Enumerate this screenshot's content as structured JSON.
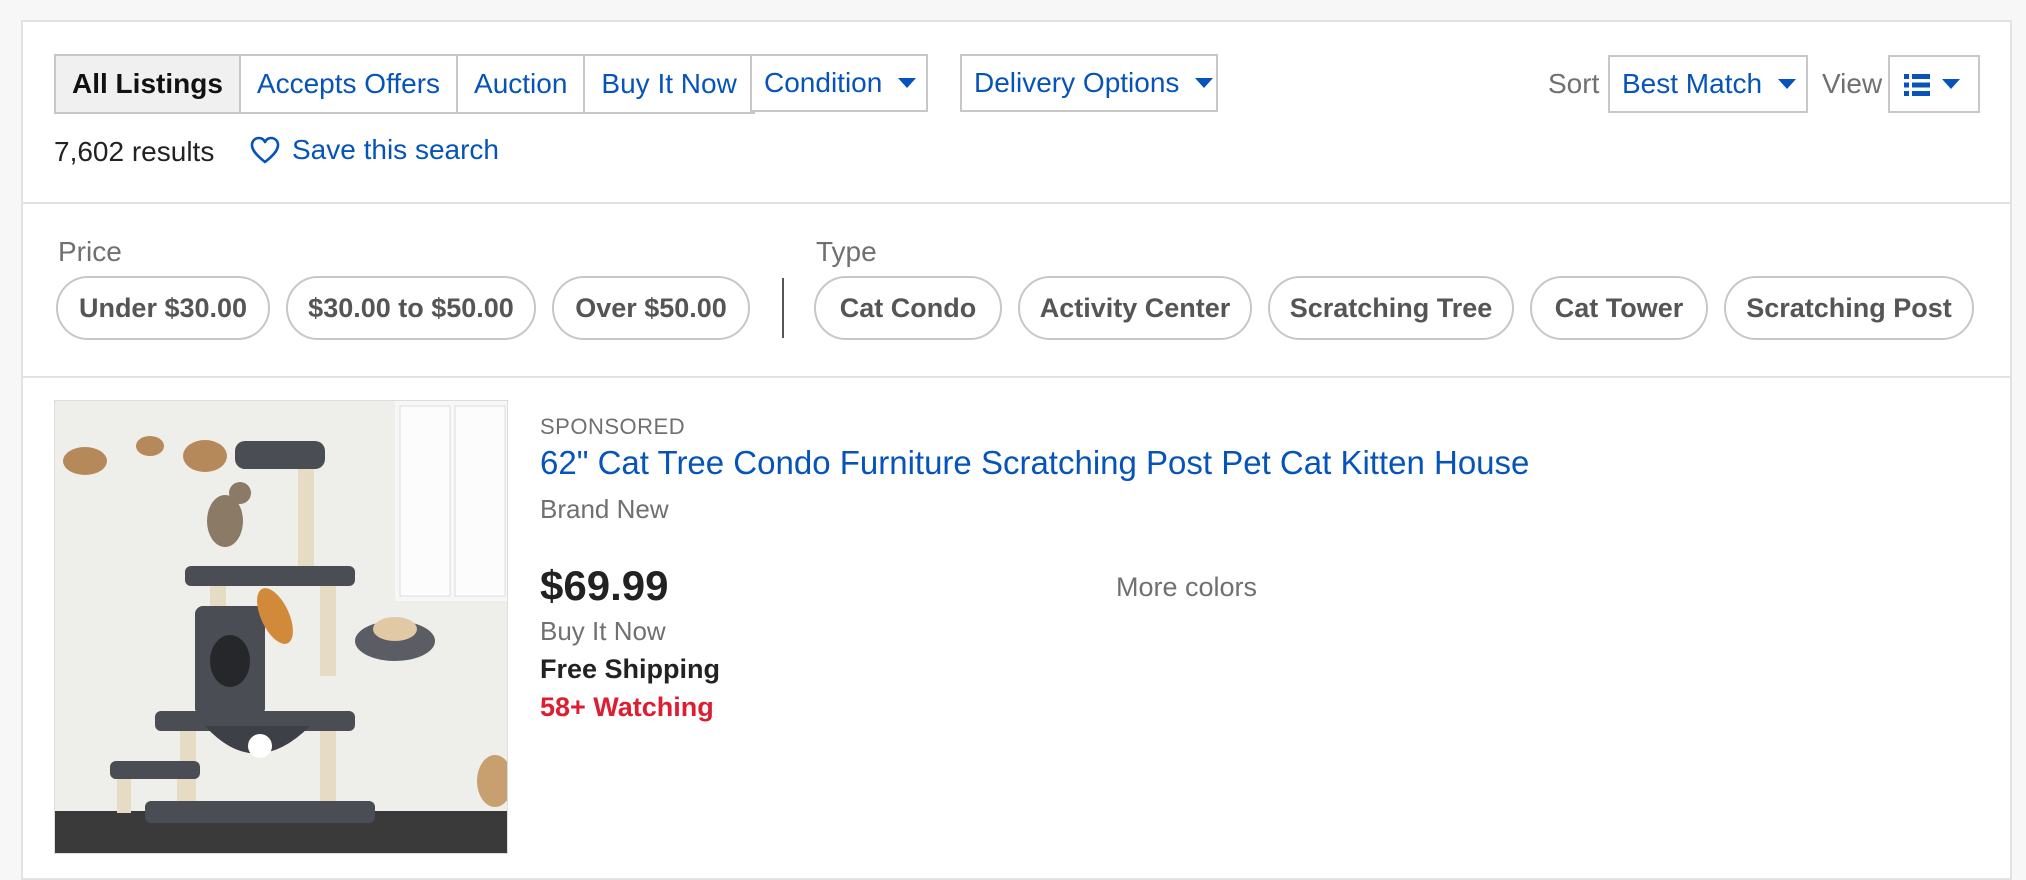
{
  "filters": {
    "format_tabs": [
      "All Listings",
      "Accepts Offers",
      "Auction",
      "Buy It Now"
    ],
    "condition_label": "Condition",
    "delivery_label": "Delivery Options",
    "sort_label": "Sort",
    "sort_value": "Best Match",
    "view_label": "View"
  },
  "summary": {
    "results": "7,602 results",
    "save_search": "Save this search"
  },
  "refine": {
    "price_label": "Price",
    "price_pills": [
      "Under $30.00",
      "$30.00 to $50.00",
      "Over $50.00"
    ],
    "type_label": "Type",
    "type_pills": [
      "Cat Condo",
      "Activity Center",
      "Scratching Tree",
      "Cat Tower",
      "Scratching Post"
    ]
  },
  "listing": {
    "sponsored": "SPONSORED",
    "title": "62\" Cat Tree Condo Furniture Scratching Post Pet Cat Kitten House",
    "condition": "Brand New",
    "price": "$69.99",
    "format": "Buy It Now",
    "shipping": "Free Shipping",
    "watching": "58+ Watching",
    "more_colors": "More colors"
  },
  "colors": {
    "link": "#0654ba",
    "watching": "#dd1e31",
    "border": "#c7c7c7"
  }
}
